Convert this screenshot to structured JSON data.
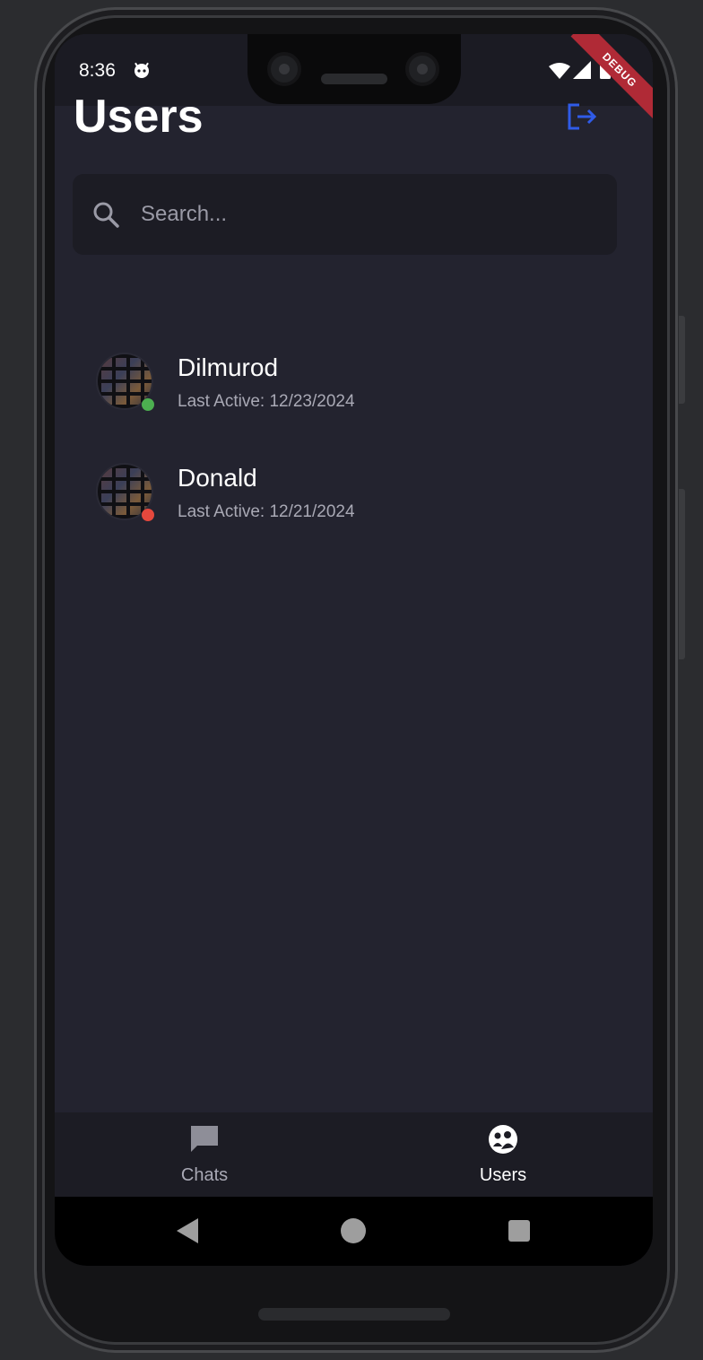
{
  "status_bar": {
    "time": "8:36"
  },
  "debug_banner": "DEBUG",
  "header": {
    "title": "Users"
  },
  "search": {
    "placeholder": "Search..."
  },
  "users": [
    {
      "name": "Dilmurod",
      "last_active": "Last Active: 12/23/2024",
      "online": true
    },
    {
      "name": "Donald",
      "last_active": "Last Active: 12/21/2024",
      "online": false
    }
  ],
  "bottom_nav": {
    "items": [
      {
        "label": "Chats",
        "icon": "chat-bubble-icon",
        "active": false
      },
      {
        "label": "Users",
        "icon": "users-icon",
        "active": true
      }
    ]
  },
  "colors": {
    "accent": "#2f5be8",
    "online": "#4caf50",
    "offline": "#e5483d",
    "background": "#23232f"
  }
}
